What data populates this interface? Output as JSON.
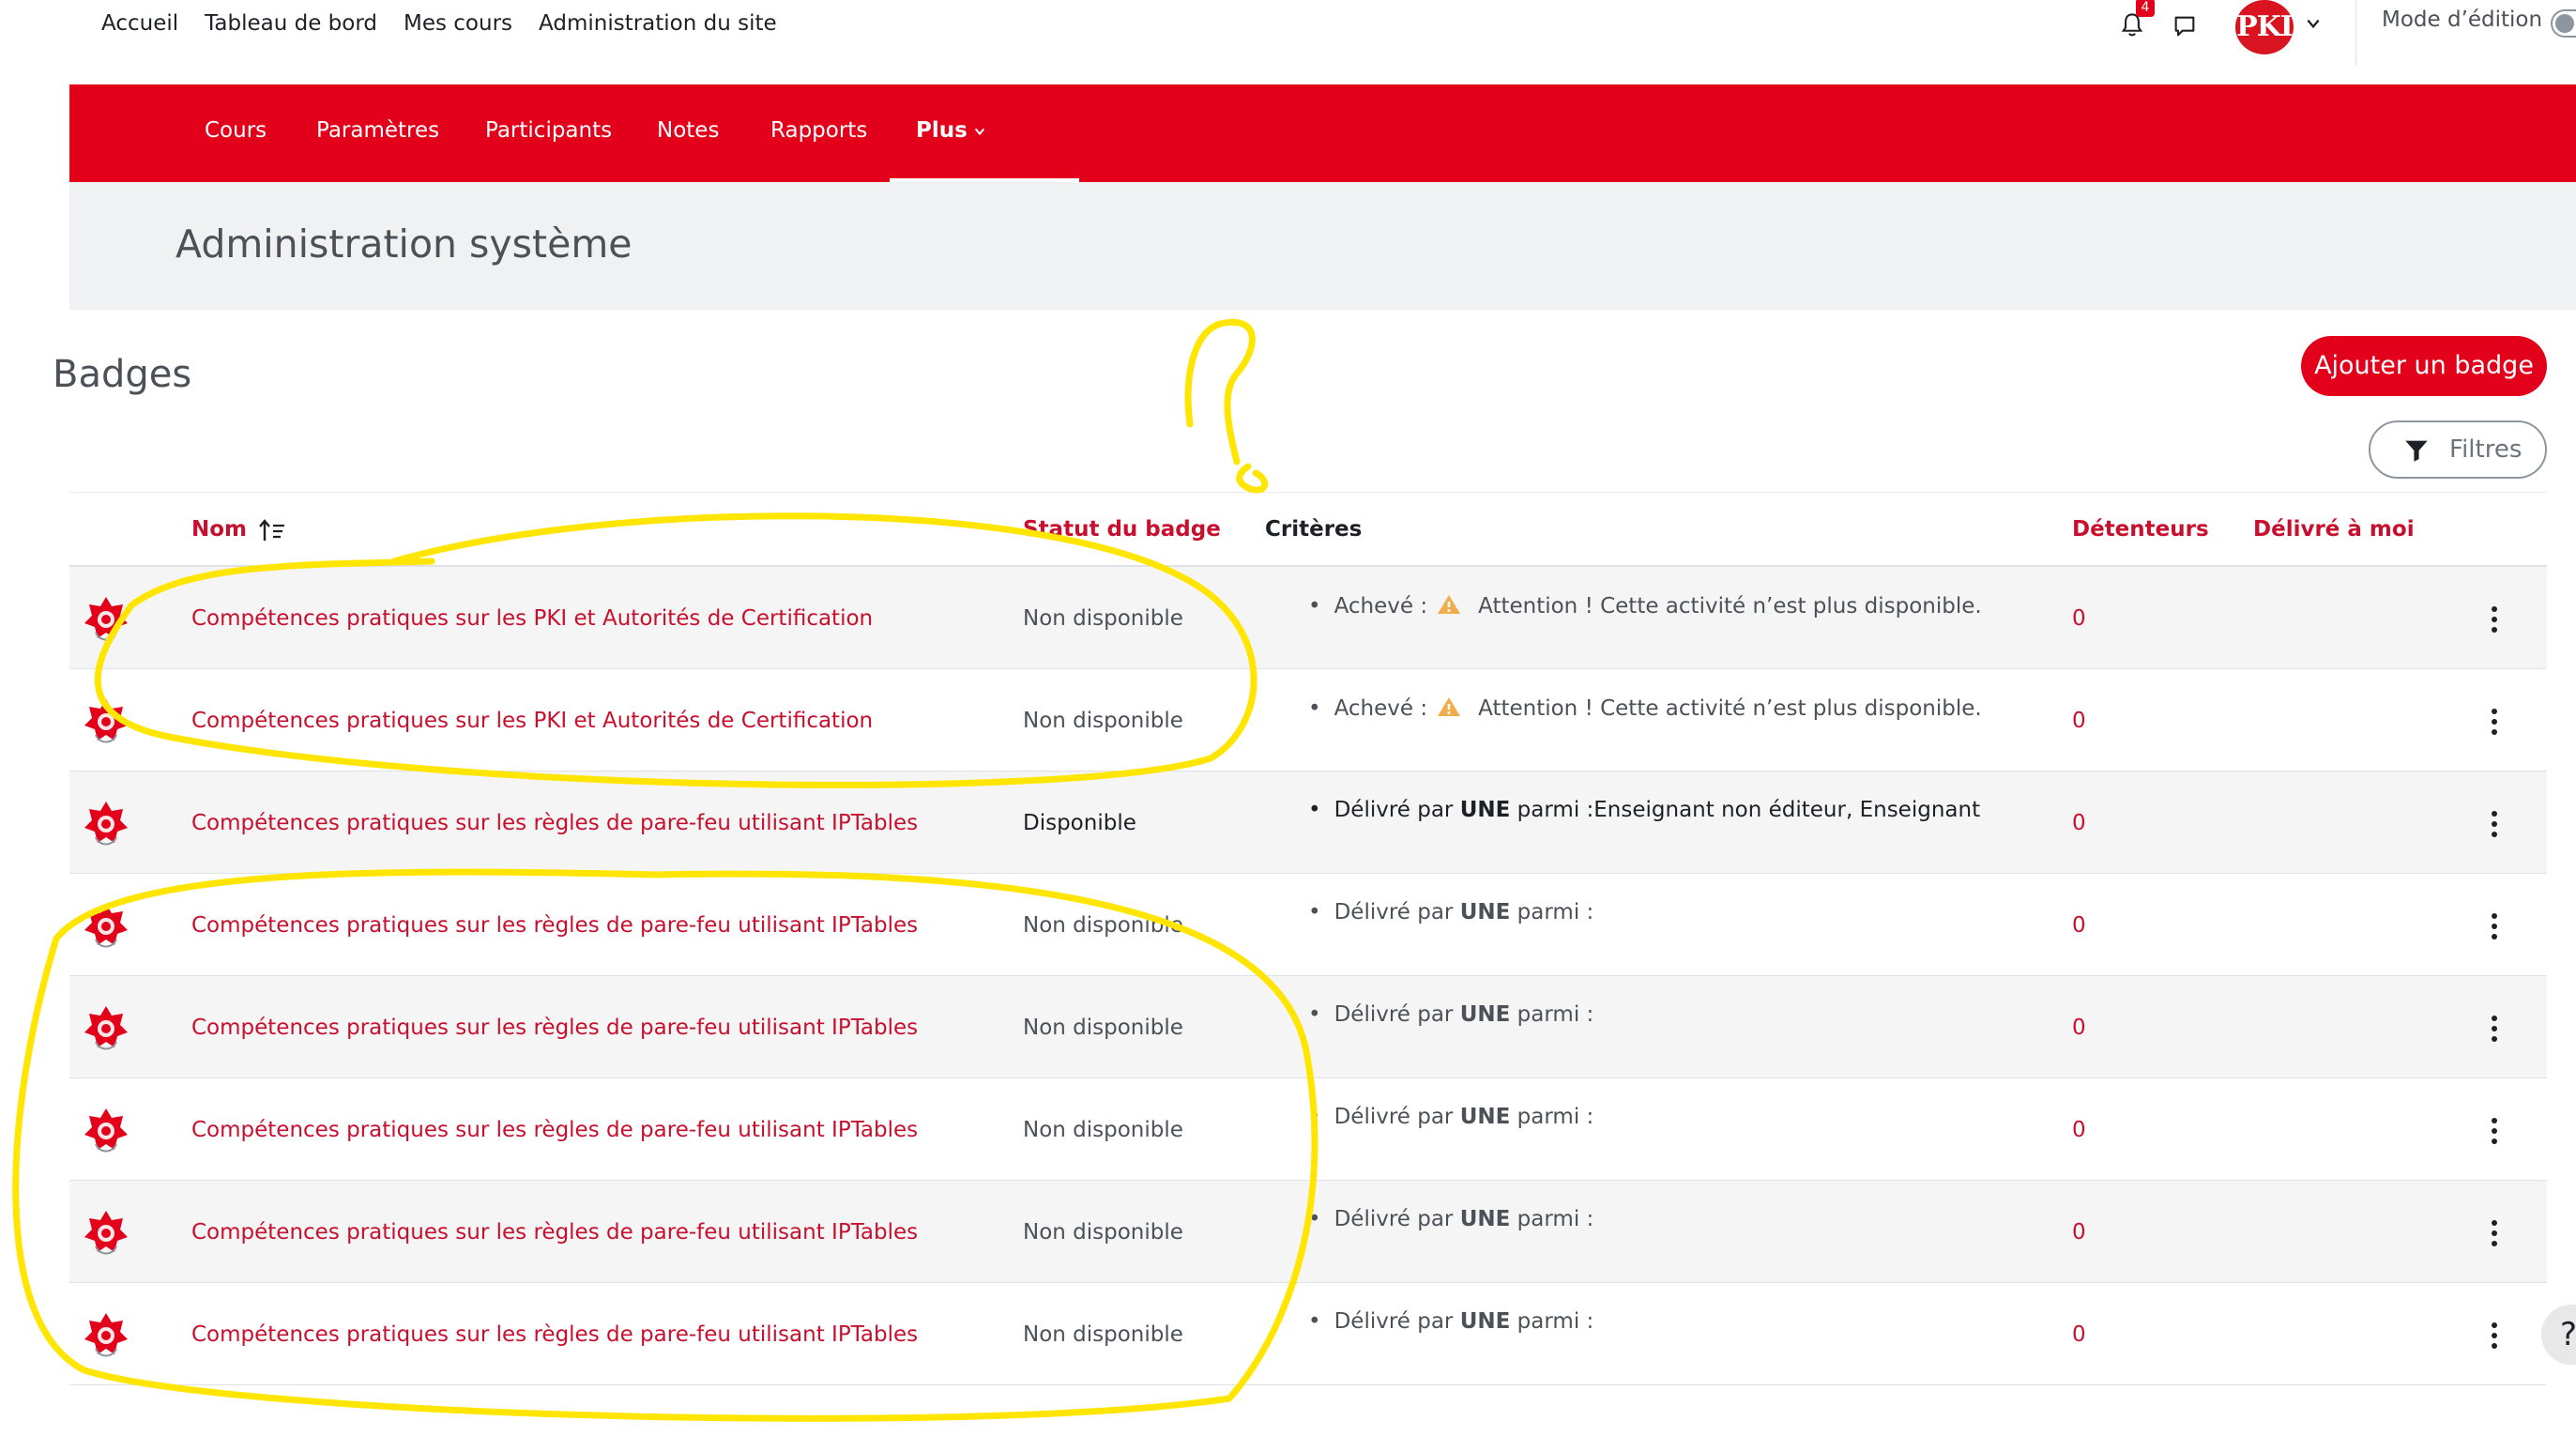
{
  "topnav": {
    "links": [
      "Accueil",
      "Tableau de bord",
      "Mes cours",
      "Administration du site"
    ],
    "notification_count": "4",
    "avatar_initials": "PKI",
    "edit_mode_label": "Mode d’édition"
  },
  "coursenav": {
    "items": [
      "Cours",
      "Paramètres",
      "Participants",
      "Notes",
      "Rapports",
      "Plus"
    ]
  },
  "page": {
    "title": "Administration système",
    "section_title": "Badges",
    "add_badge_label": "Ajouter un badge",
    "filters_label": "Filtres"
  },
  "table": {
    "headers": {
      "name": "Nom",
      "status": "Statut du badge",
      "criteria": "Critères",
      "holders": "Détenteurs",
      "delivered_to_me": "Délivré à moi"
    },
    "rows": [
      {
        "name": "Compétences pratiques sur les PKI et Autorités de Certification",
        "status": "Non disponible",
        "criteria_label": "Achevé :",
        "criteria_text": "Attention ! Cette activité n’est plus disponible.",
        "holders": "0"
      },
      {
        "name": "Compétences pratiques sur les PKI et Autorités de Certification",
        "status": "Non disponible",
        "criteria_label": "Achevé :",
        "criteria_text": "Attention ! Cette activité n’est plus disponible.",
        "holders": "0"
      },
      {
        "name": "Compétences pratiques sur les règles de pare-feu utilisant IPTables",
        "status": "Disponible",
        "criteria_prefix": "Délivré par",
        "criteria_bold": "UNE",
        "criteria_suffix": "parmi :Enseignant non éditeur, Enseignant",
        "holders": "0"
      },
      {
        "name": "Compétences pratiques sur les règles de pare-feu utilisant IPTables",
        "status": "Non disponible",
        "criteria_prefix": "Délivré par",
        "criteria_bold": "UNE",
        "criteria_suffix": "parmi :",
        "holders": "0"
      },
      {
        "name": "Compétences pratiques sur les règles de pare-feu utilisant IPTables",
        "status": "Non disponible",
        "criteria_prefix": "Délivré par",
        "criteria_bold": "UNE",
        "criteria_suffix": "parmi :",
        "holders": "0"
      },
      {
        "name": "Compétences pratiques sur les règles de pare-feu utilisant IPTables",
        "status": "Non disponible",
        "criteria_prefix": "Délivré par",
        "criteria_bold": "UNE",
        "criteria_suffix": "parmi :",
        "holders": "0"
      },
      {
        "name": "Compétences pratiques sur les règles de pare-feu utilisant IPTables",
        "status": "Non disponible",
        "criteria_prefix": "Délivré par",
        "criteria_bold": "UNE",
        "criteria_suffix": "parmi :",
        "holders": "0"
      },
      {
        "name": "Compétences pratiques sur les règles de pare-feu utilisant IPTables",
        "status": "Non disponible",
        "criteria_prefix": "Délivré par",
        "criteria_bold": "UNE",
        "criteria_suffix": "parmi :",
        "holders": "0"
      }
    ]
  },
  "help_label": "?",
  "colors": {
    "brand_red": "#e2001a",
    "link_red": "#c8102e",
    "annotation_yellow": "#ffe500",
    "page_band": "#eff1f3"
  },
  "icons": [
    "bell-icon",
    "chat-icon",
    "chevron-down-icon",
    "filter-icon",
    "sort-icon",
    "warning-icon",
    "badge-icon",
    "kebab-menu-icon",
    "help-icon"
  ]
}
